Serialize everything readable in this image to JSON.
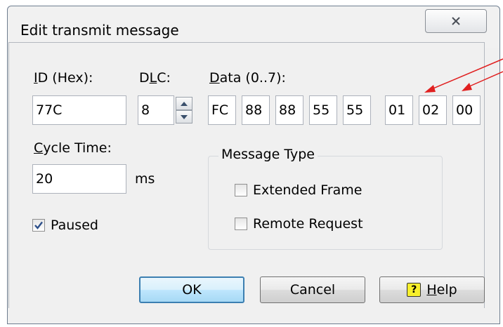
{
  "window": {
    "title": "Edit transmit message",
    "close_glyph": "✕"
  },
  "labels": {
    "id_hex": "ID (Hex):",
    "dlc": "DLC:",
    "data": "Data (0..7):",
    "cycle_time": "Cycle Time:",
    "ms": "ms"
  },
  "fields": {
    "id": "77C",
    "dlc": "8",
    "cycle_time": "20",
    "data": [
      "FC",
      "88",
      "88",
      "55",
      "55",
      "01",
      "02",
      "00"
    ]
  },
  "paused": {
    "label": "Paused",
    "checked": true
  },
  "message_type": {
    "legend": "Message Type",
    "extended_frame": {
      "label": "Extended Frame",
      "checked": false
    },
    "remote_request": {
      "label": "Remote Request",
      "checked": false
    }
  },
  "buttons": {
    "ok": "OK",
    "cancel": "Cancel",
    "help": "Help",
    "help_icon_glyph": "?"
  },
  "colors": {
    "annotation_arrow": "#e02020",
    "default_button_border": "#3c7fb1"
  }
}
